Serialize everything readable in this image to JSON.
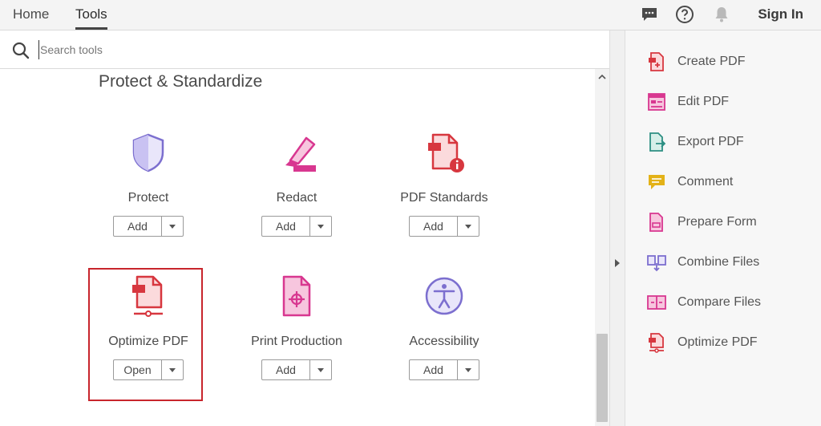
{
  "header": {
    "tabs": [
      {
        "label": "Home"
      },
      {
        "label": "Tools"
      }
    ],
    "signin_label": "Sign In"
  },
  "search": {
    "placeholder": "Search tools",
    "value": ""
  },
  "section": {
    "title": "Protect & Standardize",
    "tools": [
      {
        "label": "Protect",
        "button": "Add",
        "icon": "shield-icon"
      },
      {
        "label": "Redact",
        "button": "Add",
        "icon": "redact-marker-icon"
      },
      {
        "label": "PDF Standards",
        "button": "Add",
        "icon": "pdf-standards-icon"
      },
      {
        "label": "Optimize PDF",
        "button": "Open",
        "icon": "optimize-pdf-icon"
      },
      {
        "label": "Print Production",
        "button": "Add",
        "icon": "print-production-icon"
      },
      {
        "label": "Accessibility",
        "button": "Add",
        "icon": "accessibility-icon"
      }
    ]
  },
  "right_panel": {
    "items": [
      {
        "label": "Create PDF",
        "icon": "create-pdf-icon"
      },
      {
        "label": "Edit PDF",
        "icon": "edit-pdf-icon"
      },
      {
        "label": "Export PDF",
        "icon": "export-pdf-icon"
      },
      {
        "label": "Comment",
        "icon": "comment-icon"
      },
      {
        "label": "Prepare Form",
        "icon": "prepare-form-icon"
      },
      {
        "label": "Combine Files",
        "icon": "combine-files-icon"
      },
      {
        "label": "Compare Files",
        "icon": "compare-files-icon"
      },
      {
        "label": "Optimize PDF",
        "icon": "optimize-pdf-icon"
      }
    ]
  },
  "colors": {
    "highlight_border": "#c8252c",
    "red_icon": "#d7373f",
    "purple_icon": "#7c6fcf",
    "magenta_icon": "#d83790",
    "teal_icon": "#2d8f83",
    "yellow_icon": "#e3b218"
  }
}
